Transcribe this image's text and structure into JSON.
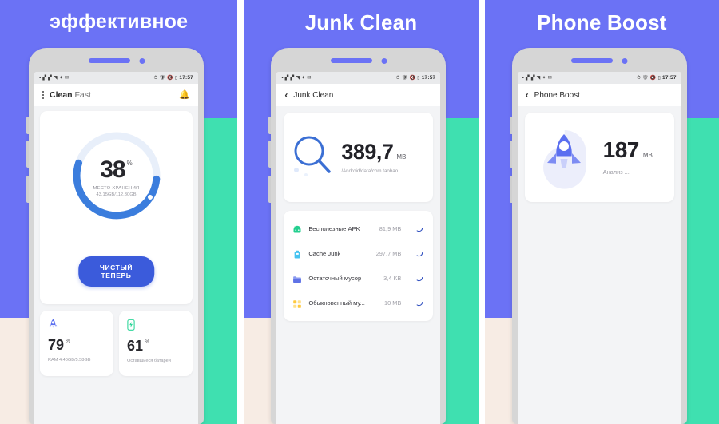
{
  "colors": {
    "purple": "#6b72f5",
    "beige": "#f7ece4",
    "teal": "#3fe0b0",
    "accent_blue": "#3b5bdb",
    "ring_track": "#e4ecfa",
    "ring_fill": "#3b7ddd",
    "bell_yellow": "#fbc02d",
    "rocket_blue": "#5b6ff0",
    "battery_green": "#2fd69a"
  },
  "panels": [
    {
      "headline": "эффективное",
      "statusbar": {
        "left_icons": [
          "sim-icon",
          "signal-bar-icon",
          "signal-bar-icon",
          "wifi-icon",
          "bluetooth-icon",
          "mail-icon"
        ],
        "right_icons": [
          "alarm-icon",
          "shield-icon",
          "mute-icon",
          "battery-icon"
        ],
        "time": "17:57"
      },
      "appbar": {
        "menu_icon": "kebab-menu-icon",
        "brand_bold": "Clean",
        "brand_light": "Fast",
        "notification_icon": "bell-icon"
      },
      "storage": {
        "percent": 38,
        "percent_symbol": "%",
        "label": "МЕСТО ХРАНЕНИЯ",
        "sub": "43.15GB/112.30GB"
      },
      "cta_label": "ЧИСТЫЙ ТЕПЕРЬ",
      "stats": [
        {
          "icon": "rocket-icon",
          "value": "79",
          "symbol": "%",
          "sub": "RAM 4.40GB/5.58GB"
        },
        {
          "icon": "battery-icon",
          "value": "61",
          "symbol": "%",
          "sub": "Оставшиеся батареи"
        }
      ]
    },
    {
      "headline": "Junk Clean",
      "statusbar": {
        "time": "17:57"
      },
      "appbar": {
        "back_icon": "back-chevron-icon",
        "title": "Junk Clean"
      },
      "scan": {
        "icon": "magnifier-icon",
        "size": "389,7",
        "unit": "MB",
        "path": "/Android/data/com.taobao..."
      },
      "junk_items": [
        {
          "icon": "android-robot-icon",
          "label": "Бесполезные APK",
          "size": "81,9 MB",
          "spinner": "loading-spinner-icon"
        },
        {
          "icon": "trash-bin-icon",
          "label": "Cache Junk",
          "size": "297,7 MB",
          "spinner": "loading-spinner-icon"
        },
        {
          "icon": "folder-icon",
          "label": "Остаточный мусор",
          "size": "3,4 KB",
          "spinner": "loading-spinner-icon"
        },
        {
          "icon": "grid-squares-icon",
          "label": "Обыкновенный му...",
          "size": "10 MB",
          "spinner": "loading-spinner-icon"
        }
      ]
    },
    {
      "headline": "Phone Boost",
      "statusbar": {
        "time": "17:57"
      },
      "appbar": {
        "back_icon": "back-chevron-icon",
        "title": "Phone Boost"
      },
      "boost": {
        "icon": "rocket-icon",
        "value": "187",
        "unit": "MB",
        "status": "Анализ ..."
      }
    }
  ]
}
